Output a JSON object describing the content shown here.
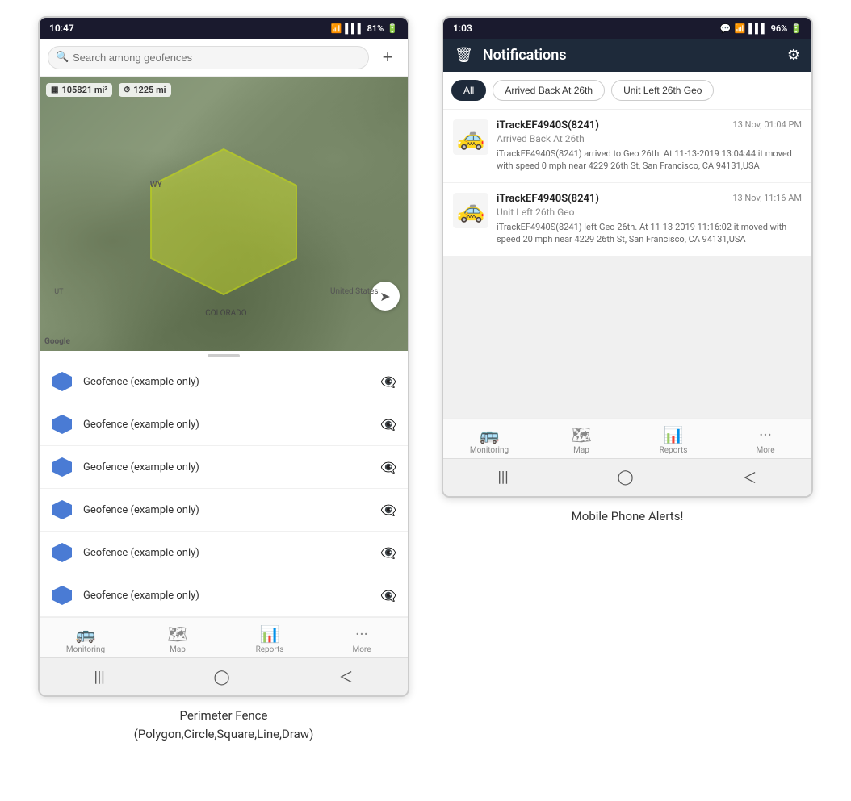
{
  "left_phone": {
    "status_bar": {
      "time": "10:47",
      "signal": "WiFi",
      "battery": "81%"
    },
    "search": {
      "placeholder": "Search among geofences"
    },
    "map": {
      "stat1": "105821 mi²",
      "stat2": "1225 mi",
      "label_wy": "WY",
      "label_us": "United States",
      "label_co": "COLORADO",
      "label_ut": "UT",
      "google": "Google"
    },
    "geofences": [
      {
        "name": "Geofence (example only)"
      },
      {
        "name": "Geofence (example only)"
      },
      {
        "name": "Geofence (example only)"
      },
      {
        "name": "Geofence (example only)"
      },
      {
        "name": "Geofence (example only)"
      },
      {
        "name": "Geofence (example only)"
      }
    ],
    "bottom_nav": [
      {
        "icon": "🚌",
        "label": "Monitoring"
      },
      {
        "icon": "🗺",
        "label": "Map"
      },
      {
        "icon": "📊",
        "label": "Reports"
      },
      {
        "icon": "···",
        "label": "More"
      }
    ],
    "caption_line1": "Perimeter Fence",
    "caption_line2": "(Polygon,Circle,Square,Line,Draw)"
  },
  "right_phone": {
    "status_bar": {
      "time": "1:03",
      "battery": "96%"
    },
    "header": {
      "title": "Notifications",
      "trash_icon": "trash",
      "gear_icon": "gear"
    },
    "filters": [
      {
        "label": "All",
        "active": true
      },
      {
        "label": "Arrived Back At 26th",
        "active": false
      },
      {
        "label": "Unit Left 26th Geo",
        "active": false
      }
    ],
    "notifications": [
      {
        "device": "iTrackEF4940S(8241)",
        "time": "13 Nov, 01:04 PM",
        "event": "Arrived Back At 26th",
        "desc": "iTrackEF4940S(8241) arrived to Geo 26th.    At 11-13-2019 13:04:44 it moved with speed 0 mph near 4229 26th St, San Francisco, CA 94131,USA"
      },
      {
        "device": "iTrackEF4940S(8241)",
        "time": "13 Nov, 11:16 AM",
        "event": "Unit Left 26th Geo",
        "desc": "iTrackEF4940S(8241) left Geo 26th.   At 11-13-2019 11:16:02 it moved with speed 20 mph near 4229 26th St, San Francisco, CA 94131,USA"
      }
    ],
    "bottom_nav": [
      {
        "icon": "🚌",
        "label": "Monitoring"
      },
      {
        "icon": "🗺",
        "label": "Map"
      },
      {
        "icon": "📊",
        "label": "Reports"
      },
      {
        "icon": "···",
        "label": "More"
      }
    ],
    "caption": "Mobile Phone Alerts!"
  }
}
